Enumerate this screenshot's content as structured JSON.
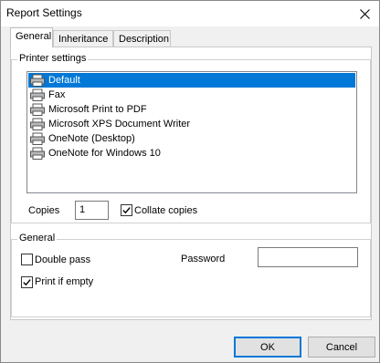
{
  "window": {
    "title": "Report Settings",
    "close_glyph": "close-icon"
  },
  "tabs": [
    {
      "label": "General",
      "active": true
    },
    {
      "label": "Inheritance",
      "active": false
    },
    {
      "label": "Description",
      "active": false
    }
  ],
  "printer_settings": {
    "legend": "Printer settings",
    "printers": [
      {
        "name": "Default",
        "selected": true
      },
      {
        "name": "Fax",
        "selected": false
      },
      {
        "name": "Microsoft Print to PDF",
        "selected": false
      },
      {
        "name": "Microsoft XPS Document Writer",
        "selected": false
      },
      {
        "name": "OneNote (Desktop)",
        "selected": false
      },
      {
        "name": "OneNote for Windows 10",
        "selected": false
      }
    ],
    "copies_label": "Copies",
    "copies_value": "1",
    "collate_label": "Collate copies",
    "collate_checked": true
  },
  "general": {
    "legend": "General",
    "double_pass_label": "Double pass",
    "double_pass_checked": false,
    "password_label": "Password",
    "password_value": "",
    "print_if_empty_label": "Print if empty",
    "print_if_empty_checked": true
  },
  "buttons": {
    "ok": "OK",
    "cancel": "Cancel"
  },
  "colors": {
    "selection": "#0078d7",
    "dialog_bg": "#f0f0f0",
    "panel_bg": "#ffffff"
  }
}
